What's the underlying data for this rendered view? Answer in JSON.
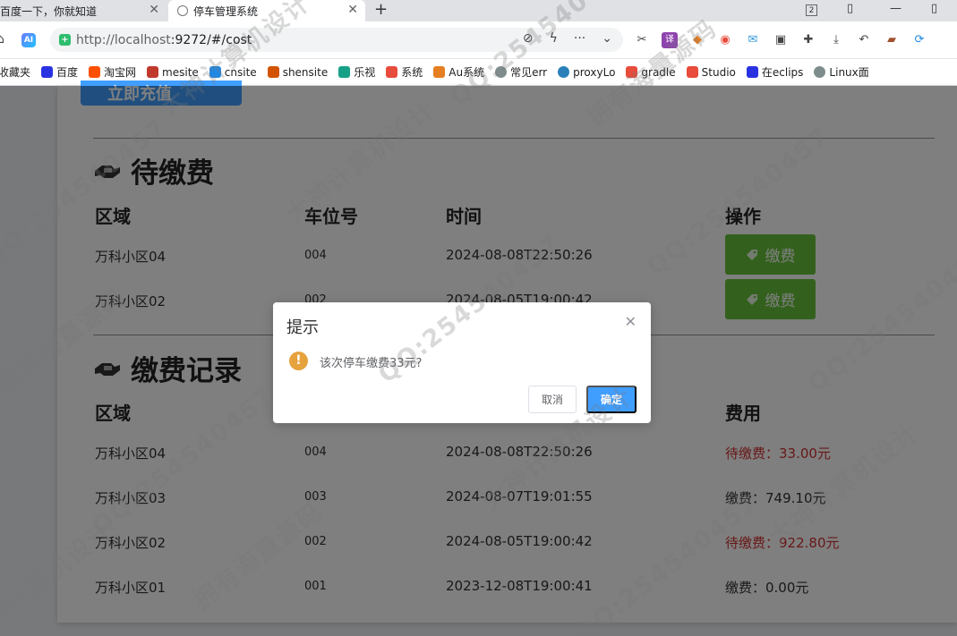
{
  "browser": {
    "tabs": [
      {
        "title": "百度一下，你就知道",
        "active": false
      },
      {
        "title": "停车管理系统",
        "active": true
      }
    ],
    "new_tab": "+",
    "window_badge": "2",
    "url_host": "http://localhost",
    "url_path": ":9272/#/cost",
    "bookmarks": [
      {
        "label": "收藏夹",
        "color": "#f5b400"
      },
      {
        "label": "百度",
        "color": "#2932e1"
      },
      {
        "label": "淘宝网",
        "color": "#ff5000"
      },
      {
        "label": "mesite",
        "color": "#c0392b"
      },
      {
        "label": "cnsite",
        "color": "#1e88e5"
      },
      {
        "label": "shensite",
        "color": "#d35400"
      },
      {
        "label": "乐视",
        "color": "#16a085"
      },
      {
        "label": "系统",
        "color": "#e74c3c"
      },
      {
        "label": "Au系统",
        "color": "#e67e22"
      },
      {
        "label": "常见err",
        "color": "#7f8c8d"
      },
      {
        "label": "proxyLo",
        "color": "#2980b9"
      },
      {
        "label": "gradle",
        "color": "#e74c3c"
      },
      {
        "label": "Studio",
        "color": "#e74c3c"
      },
      {
        "label": "在eclips",
        "color": "#2932e1"
      },
      {
        "label": "Linux面",
        "color": "#7f8c8d"
      }
    ]
  },
  "page": {
    "recharge_button": "立即充值",
    "pending": {
      "title": "待缴费",
      "headers": [
        "区域",
        "车位号",
        "时间",
        "操作"
      ],
      "rows": [
        {
          "area": "万科小区04",
          "spot": "004",
          "time": "2024-08-08T22:50:26",
          "action": "缴费"
        },
        {
          "area": "万科小区02",
          "spot": "002",
          "time": "2024-08-05T19:00:42",
          "action": "缴费"
        }
      ]
    },
    "records": {
      "title": "缴费记录",
      "headers": [
        "区域",
        "费用"
      ],
      "rows": [
        {
          "area": "万科小区04",
          "spot": "004",
          "time": "2024-08-08T22:50:26",
          "fee": "待缴费：33.00元",
          "status_color": "#d03030"
        },
        {
          "area": "万科小区03",
          "spot": "003",
          "time": "2024-08-07T19:01:55",
          "fee": "缴费：749.10元",
          "status_color": "#303133"
        },
        {
          "area": "万科小区02",
          "spot": "002",
          "time": "2024-08-05T19:00:42",
          "fee": "待缴费：922.80元",
          "status_color": "#d03030"
        },
        {
          "area": "万科小区01",
          "spot": "001",
          "time": "2023-12-08T19:00:41",
          "fee": "缴费：0.00元",
          "status_color": "#303133"
        }
      ]
    }
  },
  "dialog": {
    "title": "提示",
    "message": "该次停车缴费33元?",
    "cancel": "取消",
    "confirm": "确定"
  },
  "watermark": {
    "texts": [
      "大神计算机设计",
      "QQ:254540457",
      "拥有海量源码"
    ]
  },
  "colors": {
    "primary": "#409eff",
    "success": "#67c23a",
    "warning": "#e6a23c",
    "danger_text": "#d03030"
  }
}
